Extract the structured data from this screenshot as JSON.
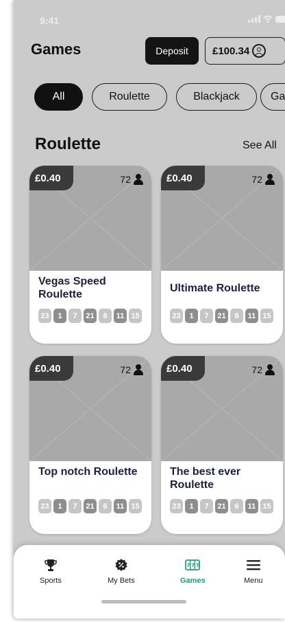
{
  "status": {
    "time": "9:41"
  },
  "header": {
    "title": "Games",
    "deposit_label": "Deposit",
    "balance": "£100.34"
  },
  "filters": [
    {
      "label": "All",
      "active": true
    },
    {
      "label": "Roulette",
      "active": false
    },
    {
      "label": "Blackjack",
      "active": false
    },
    {
      "label": "Ga",
      "active": false
    }
  ],
  "section": {
    "title": "Roulette",
    "see_all": "See All"
  },
  "games": [
    {
      "price": "£0.40",
      "players": "72",
      "name": "Vegas Speed Roulette"
    },
    {
      "price": "£0.40",
      "players": "72",
      "name": "Ultimate Roulette"
    },
    {
      "price": "£0.40",
      "players": "72",
      "name": "Top notch Roulette"
    },
    {
      "price": "£0.40",
      "players": "72",
      "name": "The best ever Roulette"
    }
  ],
  "recent_numbers": [
    "23",
    "1",
    "7",
    "21",
    "6",
    "11",
    "15"
  ],
  "nav": {
    "items": [
      {
        "label": "Sports",
        "icon": "trophy-icon"
      },
      {
        "label": "My Bets",
        "icon": "bets-badge-icon"
      },
      {
        "label": "Games",
        "icon": "slots-icon",
        "active": true
      },
      {
        "label": "Menu",
        "icon": "hamburger-menu-icon"
      }
    ]
  },
  "colors": {
    "accent": "#1aa37a",
    "chip_active": "#111111",
    "price_tag": "#3a3a3a"
  }
}
